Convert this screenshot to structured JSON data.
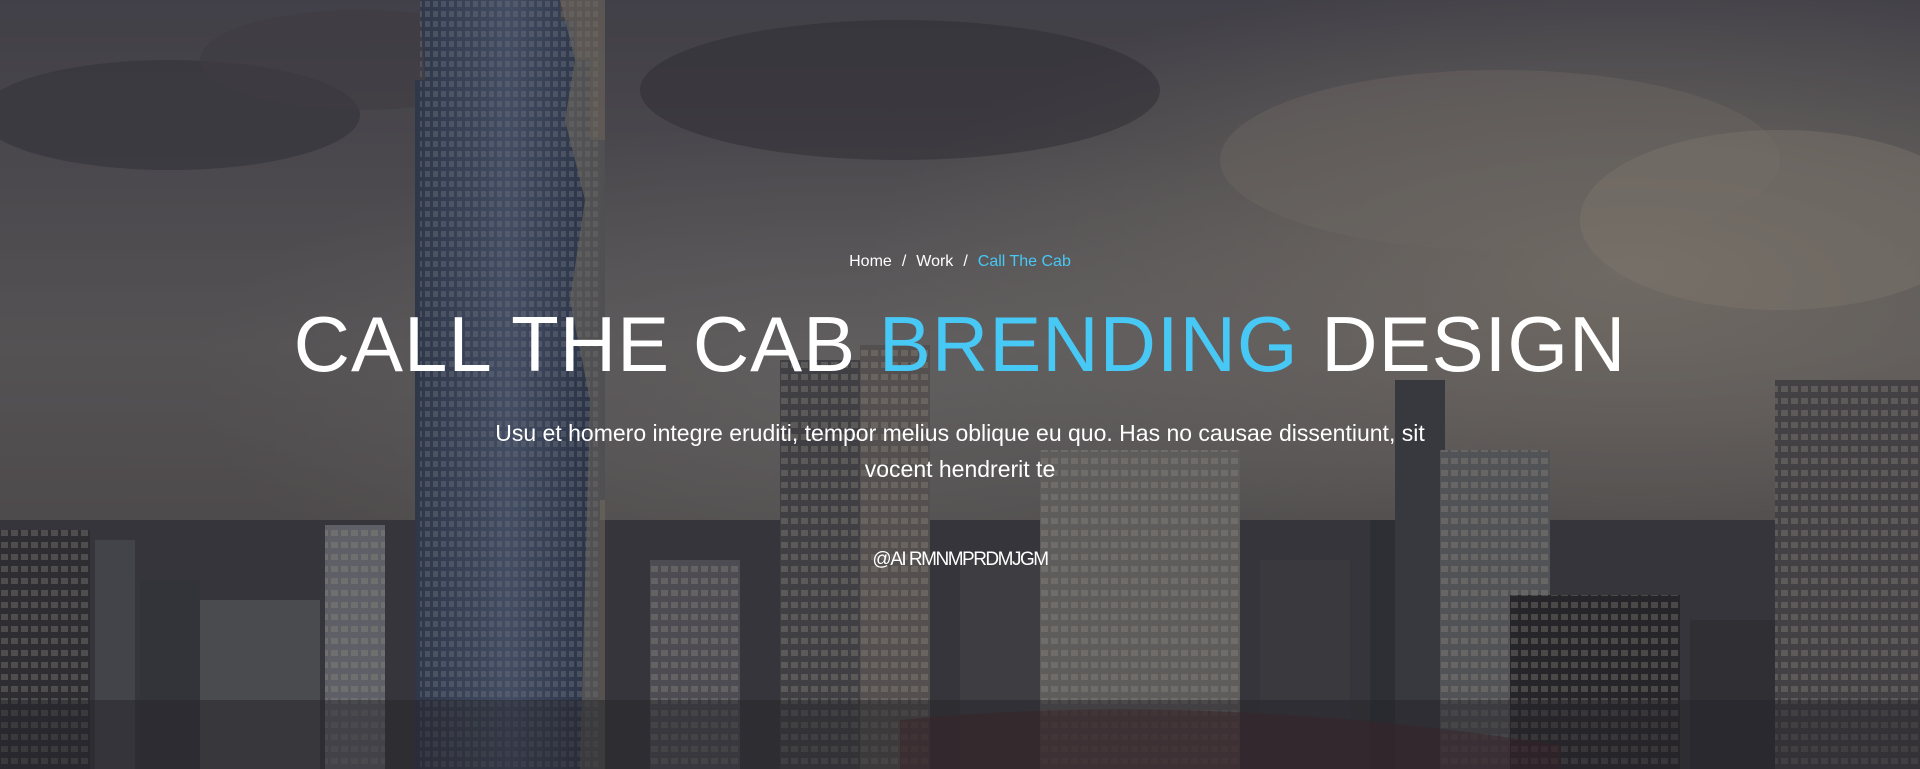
{
  "breadcrumb": {
    "items": [
      {
        "label": "Home"
      },
      {
        "label": "Work"
      },
      {
        "label": "Call The Cab"
      }
    ],
    "separator": "/"
  },
  "hero": {
    "title_part1": "CALL THE CAB ",
    "title_accent": "BRENDING",
    "title_part2": " DESIGN",
    "subtitle": "Usu et homero integre eruditi, tempor melius oblique eu quo. Has no causae dissentiunt, sit vocent hendrerit te",
    "email": "@AI RMNMPRDMJGM"
  },
  "colors": {
    "accent": "#47c8f5",
    "text": "#ffffff",
    "overlay": "#18161a"
  }
}
